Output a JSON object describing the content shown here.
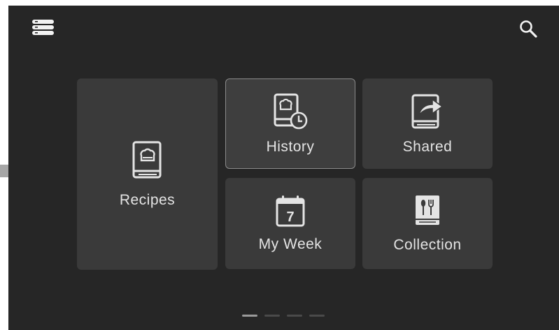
{
  "colors": {
    "background": "#262626",
    "tile": "#3a3a3a",
    "text": "#e4e4e4",
    "accent": "#ffffff"
  },
  "header": {
    "menu_icon": "menu-icon",
    "search_icon": "search-icon"
  },
  "tiles": [
    {
      "label": "Recipes",
      "icon": "recipe-book-icon"
    },
    {
      "label": "History",
      "icon": "history-book-clock-icon",
      "selected": true
    },
    {
      "label": "Shared",
      "icon": "share-book-icon"
    },
    {
      "label": "My Week",
      "icon": "calendar-7-icon"
    },
    {
      "label": "Collection",
      "icon": "cutlery-book-icon"
    }
  ],
  "calendar_day": "7",
  "pager": {
    "pages": 4,
    "current": 1
  }
}
